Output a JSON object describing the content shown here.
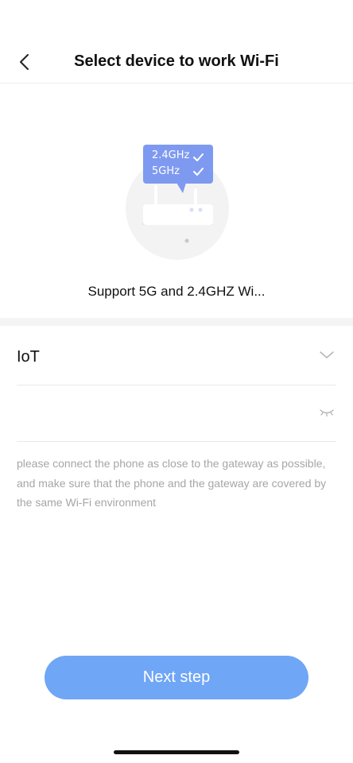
{
  "header": {
    "title": "Select device to work Wi-Fi",
    "back_icon": "chevron-left-icon"
  },
  "hero": {
    "badge_24": "2.4GHz",
    "badge_5": "5GHz",
    "support_text": "Support 5G and 2.4GHZ Wi..."
  },
  "form": {
    "ssid_value": "IoT",
    "ssid_icon": "chevron-down-icon",
    "password_value": "",
    "password_icon": "eye-closed-icon"
  },
  "hint": "please connect the phone as close to the gateway as possible, and make sure that the phone and the gateway are covered by the same Wi-Fi environment",
  "actions": {
    "next_label": "Next step"
  },
  "colors": {
    "accent": "#6fa6f6",
    "badge": "#7e9af0",
    "hint_text": "#a6a6a6"
  }
}
